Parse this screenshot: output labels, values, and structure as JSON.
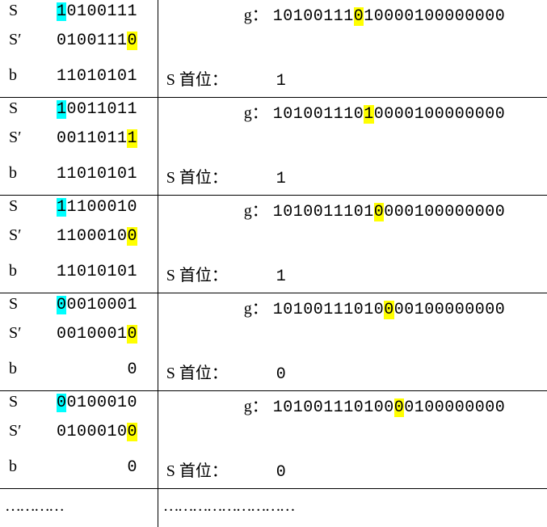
{
  "labels": {
    "S": "S",
    "Sp": "S′",
    "b": "b",
    "g": "g：",
    "sHead": "S 首位："
  },
  "groups": [
    {
      "S": {
        "bits": "10100111",
        "cyan": 0
      },
      "Sp": {
        "bits": "01001110",
        "yellow": 7
      },
      "b": {
        "bits": "11010101"
      },
      "g": {
        "bits": "10100111010000100000000",
        "yellow": 8
      },
      "sHead": "1"
    },
    {
      "S": {
        "bits": "10011011",
        "cyan": 0
      },
      "Sp": {
        "bits": "00110111",
        "yellow": 7
      },
      "b": {
        "bits": "11010101"
      },
      "g": {
        "bits": "10100111010000100000000",
        "yellow": 9
      },
      "sHead": "1"
    },
    {
      "S": {
        "bits": "11100010",
        "cyan": 0
      },
      "Sp": {
        "bits": "11000100",
        "yellow": 7
      },
      "b": {
        "bits": "11010101"
      },
      "g": {
        "bits": "10100111010000100000000",
        "yellow": 10
      },
      "sHead": "1"
    },
    {
      "S": {
        "bits": "00010001",
        "cyan": 0
      },
      "Sp": {
        "bits": "00100010",
        "yellow": 7
      },
      "b": {
        "bits": "0"
      },
      "g": {
        "bits": "10100111010000100000000",
        "yellow": 11
      },
      "sHead": "0"
    },
    {
      "S": {
        "bits": "00100010",
        "cyan": 0
      },
      "Sp": {
        "bits": "01000100",
        "yellow": 7
      },
      "b": {
        "bits": "0"
      },
      "g": {
        "bits": "10100111010000100000000",
        "yellow": 12
      },
      "sHead": "0"
    }
  ],
  "dotsLeft": "…………",
  "dotsRight": "………………………"
}
